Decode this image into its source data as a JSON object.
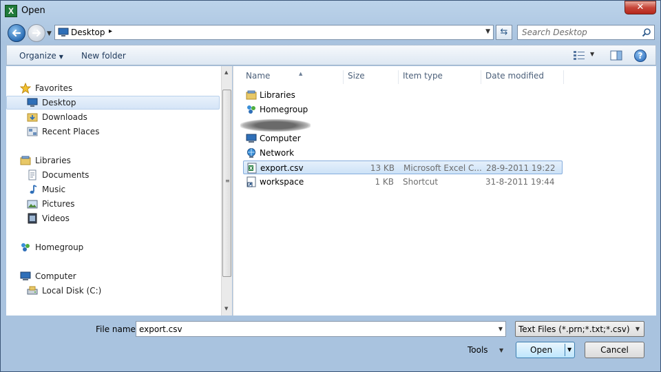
{
  "window": {
    "title": "Open",
    "close_glyph": "✕"
  },
  "navigation": {
    "back_icon": "back-arrow-icon",
    "forward_icon": "forward-arrow-icon"
  },
  "address": {
    "location": "Desktop",
    "separator": "▸",
    "search_placeholder": "Search Desktop"
  },
  "toolbar": {
    "organize_label": "Organize",
    "new_folder_label": "New folder",
    "help_glyph": "?"
  },
  "sidebar": {
    "favorites": {
      "label": "Favorites",
      "items": [
        "Desktop",
        "Downloads",
        "Recent Places"
      ]
    },
    "libraries": {
      "label": "Libraries",
      "items": [
        "Documents",
        "Music",
        "Pictures",
        "Videos"
      ]
    },
    "homegroup": {
      "label": "Homegroup"
    },
    "computer": {
      "label": "Computer",
      "items": [
        "Local Disk (C:)"
      ]
    },
    "selected": "Desktop"
  },
  "file_list": {
    "columns": [
      "Name",
      "Size",
      "Item type",
      "Date modified"
    ],
    "rows": [
      {
        "name": "Libraries",
        "size": "",
        "type": "",
        "date": ""
      },
      {
        "name": "Homegroup",
        "size": "",
        "type": "",
        "date": ""
      },
      {
        "name": "Computer",
        "size": "",
        "type": "",
        "date": ""
      },
      {
        "name": "Network",
        "size": "",
        "type": "",
        "date": ""
      },
      {
        "name": "export.csv",
        "size": "13 KB",
        "type": "Microsoft Excel C...",
        "date": "28-9-2011 19:22"
      },
      {
        "name": "workspace",
        "size": "1 KB",
        "type": "Shortcut",
        "date": "31-8-2011 19:44"
      }
    ],
    "selected": "export.csv"
  },
  "footer": {
    "file_name_label": "File name:",
    "file_name_value": "export.csv",
    "file_type_value": "Text Files (*.prn;*.txt;*.csv)",
    "tools_label": "Tools",
    "open_label": "Open",
    "cancel_label": "Cancel"
  },
  "colors": {
    "accent": "#3c7fb1",
    "selection": "#cde2f7",
    "close_button": "#c7463a"
  }
}
